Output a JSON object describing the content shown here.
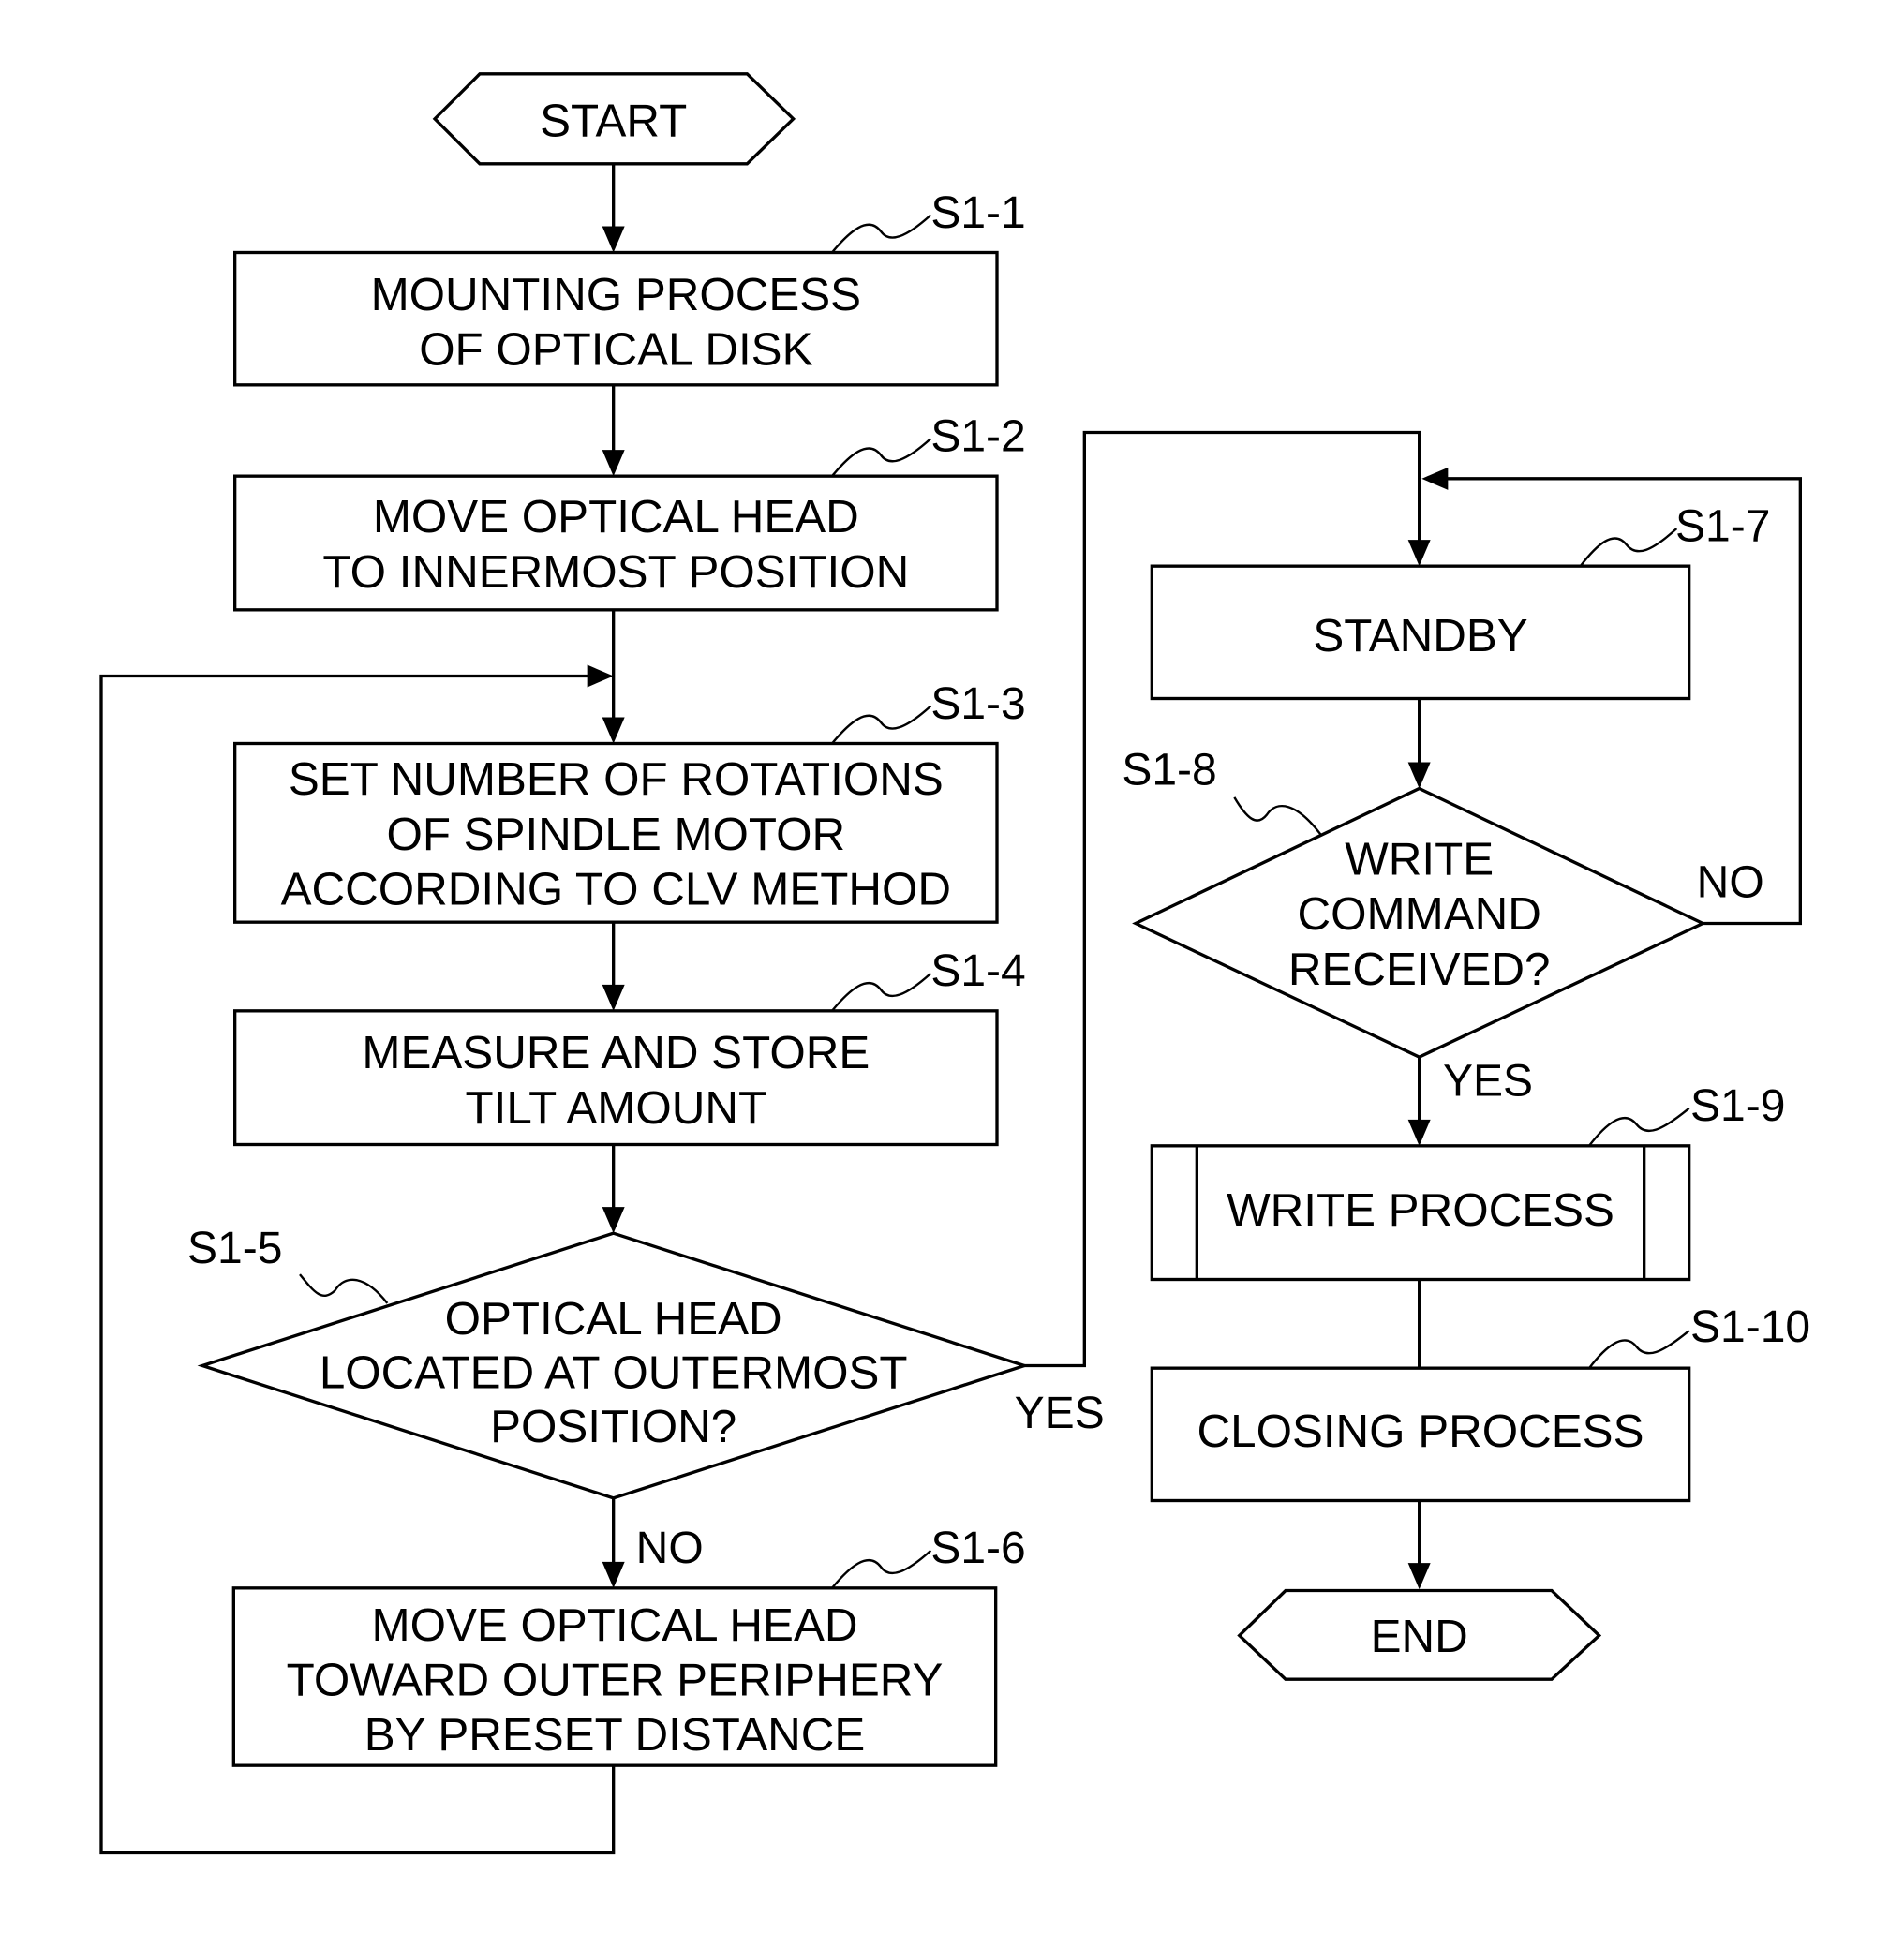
{
  "diagram": {
    "type": "flowchart",
    "terminals": {
      "start": "START",
      "end": "END"
    },
    "nodes": [
      {
        "id": "S1-1",
        "step_label": "S1-1",
        "kind": "process",
        "lines": [
          "MOUNTING PROCESS",
          "OF OPTICAL DISK"
        ]
      },
      {
        "id": "S1-2",
        "step_label": "S1-2",
        "kind": "process",
        "lines": [
          "MOVE OPTICAL HEAD",
          "TO INNERMOST POSITION"
        ]
      },
      {
        "id": "S1-3",
        "step_label": "S1-3",
        "kind": "process",
        "lines": [
          "SET NUMBER OF ROTATIONS",
          "OF SPINDLE MOTOR",
          "ACCORDING TO CLV METHOD"
        ]
      },
      {
        "id": "S1-4",
        "step_label": "S1-4",
        "kind": "process",
        "lines": [
          "MEASURE AND STORE",
          "TILT AMOUNT"
        ]
      },
      {
        "id": "S1-5",
        "step_label": "S1-5",
        "kind": "decision",
        "lines": [
          "OPTICAL HEAD",
          "LOCATED AT OUTERMOST",
          "POSITION?"
        ]
      },
      {
        "id": "S1-6",
        "step_label": "S1-6",
        "kind": "process",
        "lines": [
          "MOVE OPTICAL HEAD",
          "TOWARD OUTER PERIPHERY",
          "BY PRESET DISTANCE"
        ]
      },
      {
        "id": "S1-7",
        "step_label": "S1-7",
        "kind": "process",
        "lines": [
          "STANDBY"
        ]
      },
      {
        "id": "S1-8",
        "step_label": "S1-8",
        "kind": "decision",
        "lines": [
          "WRITE",
          "COMMAND",
          "RECEIVED?"
        ]
      },
      {
        "id": "S1-9",
        "step_label": "S1-9",
        "kind": "predefined-process",
        "lines": [
          "WRITE PROCESS"
        ]
      },
      {
        "id": "S1-10",
        "step_label": "S1-10",
        "kind": "process",
        "lines": [
          "CLOSING PROCESS"
        ]
      }
    ],
    "branch_labels": {
      "s1_5_yes": "YES",
      "s1_5_no": "NO",
      "s1_8_yes": "YES",
      "s1_8_no": "NO"
    },
    "edges": [
      {
        "from": "START",
        "to": "S1-1"
      },
      {
        "from": "S1-1",
        "to": "S1-2"
      },
      {
        "from": "S1-2",
        "to": "S1-3"
      },
      {
        "from": "S1-3",
        "to": "S1-4"
      },
      {
        "from": "S1-4",
        "to": "S1-5"
      },
      {
        "from": "S1-5",
        "to": "S1-6",
        "label": "NO"
      },
      {
        "from": "S1-6",
        "to": "S1-3"
      },
      {
        "from": "S1-5",
        "to": "S1-7",
        "label": "YES"
      },
      {
        "from": "S1-7",
        "to": "S1-8"
      },
      {
        "from": "S1-8",
        "to": "S1-7",
        "label": "NO"
      },
      {
        "from": "S1-8",
        "to": "S1-9",
        "label": "YES"
      },
      {
        "from": "S1-9",
        "to": "S1-10"
      },
      {
        "from": "S1-10",
        "to": "END"
      }
    ]
  }
}
